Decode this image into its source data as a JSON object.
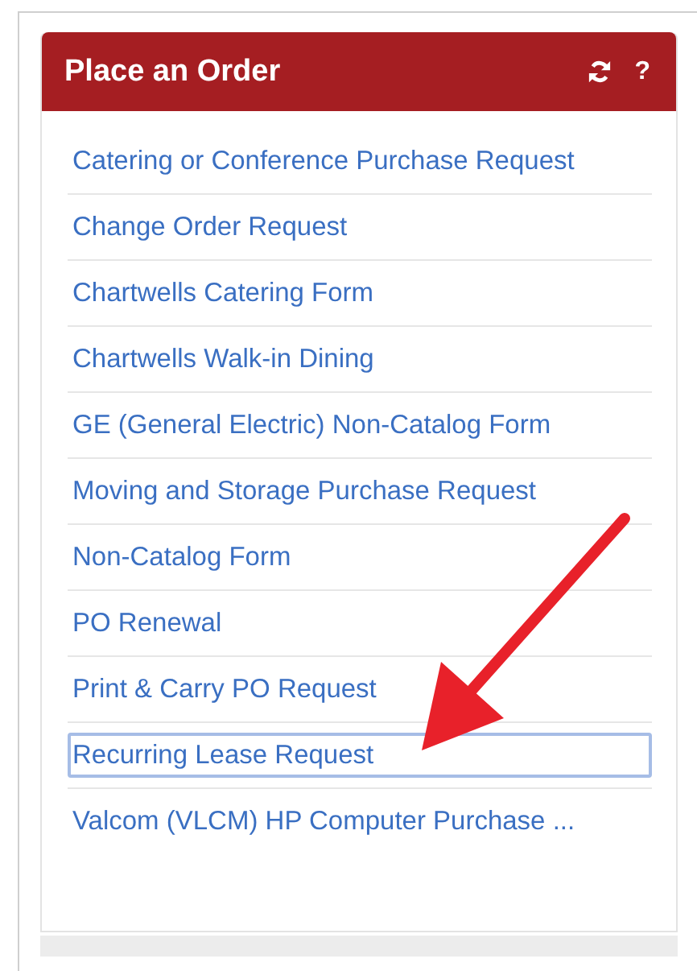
{
  "panel": {
    "title": "Place an Order",
    "help": "?",
    "items": [
      {
        "label": "Catering or Conference Purchase Request",
        "selected": false
      },
      {
        "label": "Change Order Request",
        "selected": false
      },
      {
        "label": "Chartwells Catering Form",
        "selected": false
      },
      {
        "label": "Chartwells Walk-in Dining",
        "selected": false
      },
      {
        "label": "GE (General Electric) Non-Catalog Form",
        "selected": false
      },
      {
        "label": "Moving and Storage Purchase Request",
        "selected": false
      },
      {
        "label": "Non-Catalog Form",
        "selected": false
      },
      {
        "label": "PO Renewal",
        "selected": false
      },
      {
        "label": "Print & Carry PO Request",
        "selected": false
      },
      {
        "label": "Recurring Lease Request",
        "selected": true
      },
      {
        "label": "Valcom (VLCM) HP Computer Purchase ...",
        "selected": false
      }
    ]
  }
}
